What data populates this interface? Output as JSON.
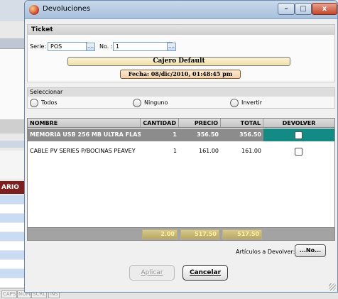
{
  "window": {
    "title": "Devoluciones",
    "controls": {
      "minimize": "–",
      "maximize": "□",
      "close": "x"
    }
  },
  "background": {
    "column_header": "ARIO",
    "row_colors": [
      "#c9dcf3",
      "#ffffff"
    ],
    "statusbar": [
      "CAPS",
      "NUM",
      "SCRL",
      "INS"
    ]
  },
  "ticket": {
    "section_title": "Ticket",
    "serie_label": "Serie:",
    "serie_value": "POS",
    "no_label": "No. :",
    "no_value": "1",
    "dots_label": "....",
    "cajero": "Cajero Default",
    "fecha": "Fecha: 08/dic/2010, 01:48:45 pm"
  },
  "seleccionar": {
    "title": "Seleccionar",
    "options": [
      "Todos",
      "Ninguno",
      "Invertir"
    ]
  },
  "grid": {
    "headers": [
      "NOMBRE",
      "CANTIDAD",
      "PRECIO",
      "TOTAL",
      "DEVOLVER"
    ],
    "rows": [
      {
        "nombre": "MEMORIA USB 256 MB ULTRA FLASH",
        "cantidad": "1",
        "precio": "356.50",
        "total": "356.50",
        "devolver": false,
        "selected": true
      },
      {
        "nombre": "CABLE PV SERIES P/BOCINAS PEAVEY",
        "cantidad": "1",
        "precio": "161.00",
        "total": "161.00",
        "devolver": false,
        "selected": false
      }
    ],
    "footer": {
      "cantidad": "2.00",
      "precio": "517.50",
      "total": "517.50"
    },
    "colors": {
      "selected_row": "#8c8c8c",
      "selected_check_cell": "#138a83",
      "footer_text": "#ffef9e"
    }
  },
  "articulos": {
    "label": "Artículos a Devolver:",
    "button": "...No..."
  },
  "buttons": {
    "aplicar": "Aplicar",
    "cancelar": "Cancelar"
  }
}
